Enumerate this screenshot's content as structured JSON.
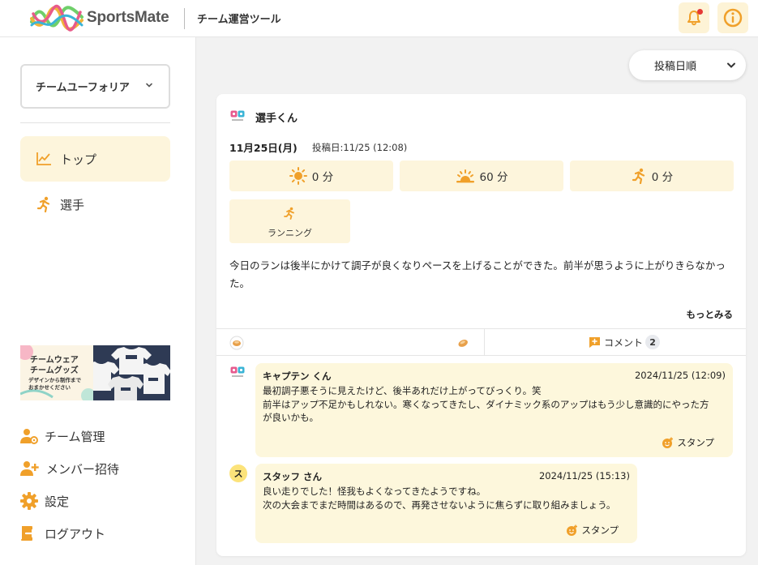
{
  "header": {
    "logo_text": "SportsMate",
    "subtitle": "チーム運営ツール"
  },
  "sidebar": {
    "team_name": "チームユーフォリア",
    "nav": [
      {
        "label": "トップ",
        "icon": "chart-icon",
        "active": true
      },
      {
        "label": "選手",
        "icon": "runner-icon",
        "active": false
      }
    ],
    "banner": {
      "line1": "チームウェア",
      "line2": "チームグッズ",
      "line3": "デザインから制作まで",
      "line4": "おまかせください"
    },
    "links": [
      {
        "label": "チーム管理",
        "icon": "team-admin-icon"
      },
      {
        "label": "メンバー招待",
        "icon": "add-user-icon"
      },
      {
        "label": "設定",
        "icon": "gear-icon"
      },
      {
        "label": "ログアウト",
        "icon": "logout-icon"
      }
    ]
  },
  "sort": {
    "label": "投稿日順"
  },
  "post": {
    "author": "選手くん",
    "date": "11月25日(月)",
    "posted_at": "投稿日:11/25 (12:08)",
    "stats": [
      {
        "icon": "sun-icon",
        "value": "0 分"
      },
      {
        "icon": "sunset-icon",
        "value": "60 分"
      },
      {
        "icon": "runner-icon",
        "value": "0 分"
      }
    ],
    "activity": {
      "icon": "running-icon",
      "label": "ランニング"
    },
    "body": "今日のランは後半にかけて調子が良くなりペースを上げることができた。前半が思うように上がりきらなかった。",
    "more": "もっとみる",
    "comment_label": "コメント",
    "comment_count": "2"
  },
  "comments": [
    {
      "author": "キャプテン くん",
      "time": "2024/11/25 (12:09)",
      "lines": [
        "最初調子悪そうに見えたけど、後半あれだけ上がってびっくり。笑",
        "前半はアップ不足かもしれない。寒くなってきたし、ダイナミック系のアップはもう少し意識的にやった方",
        "が良いかも。"
      ],
      "stamp": "スタンプ"
    },
    {
      "author": "スタッフ さん",
      "avatar": "ス",
      "time": "2024/11/25 (15:13)",
      "lines": [
        "良い走りでした！怪我もよくなってきたようですね。",
        "次の大会までまだ時間はあるので、再発させないように焦らずに取り組みましょう。"
      ],
      "stamp": "スタンプ"
    }
  ],
  "colors": {
    "accent": "#f0a02a",
    "highlight_bg": "#fdf5dc",
    "notification_dot": "#e53935"
  }
}
